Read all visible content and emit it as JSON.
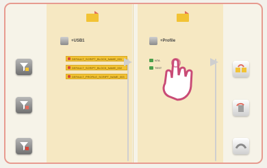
{
  "left_pane": {
    "header_label": "+USB1",
    "files": [
      "DEFAULT_SCRIPT_BLOCK_NAME_001",
      "DEFAULT_SCRIPT_BLOCK_NAME_002",
      "DEFAULT_PROFILE_SCRIPT_NAME_003"
    ]
  },
  "right_pane": {
    "header_label": "+Profile",
    "files": [
      "NTA",
      "TEST"
    ]
  },
  "icons": {
    "left_folder": "folder-open-icon",
    "right_folder": "folder-open-icon",
    "left_btn_1": "filter-copy-icon",
    "left_btn_2": "filter-delete-icon",
    "left_btn_3": "filter-new-icon",
    "right_btn_1": "folder-transfer-icon",
    "right_btn_2": "delete-icon",
    "right_btn_3": "back-icon"
  },
  "colors": {
    "accent": "#f2c335",
    "frame": "#e79a8f",
    "panel": "#f6e8c2"
  }
}
